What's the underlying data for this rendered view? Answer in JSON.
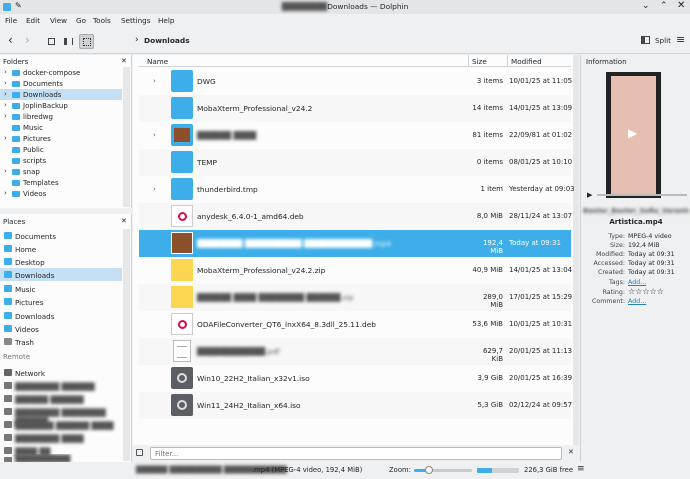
{
  "window": {
    "title_prefix": "████████",
    "title": "Downloads — Dolphin"
  },
  "menu": [
    "File",
    "Edit",
    "View",
    "Go",
    "Tools",
    "Settings",
    "Help"
  ],
  "toolbar": {
    "location": "Downloads",
    "split_label": "Split"
  },
  "folders_panel": {
    "title": "Folders",
    "items": [
      {
        "label": "docker-compose"
      },
      {
        "label": "Documents"
      },
      {
        "label": "Downloads"
      },
      {
        "label": "JoplinBackup"
      },
      {
        "label": "libredwg"
      },
      {
        "label": "Music"
      },
      {
        "label": "Pictures"
      },
      {
        "label": "Public"
      },
      {
        "label": "scripts"
      },
      {
        "label": "snap"
      },
      {
        "label": "Templates"
      },
      {
        "label": "Videos"
      }
    ]
  },
  "places_panel": {
    "title": "Places",
    "items": [
      {
        "label": "Documents"
      },
      {
        "label": "Home"
      },
      {
        "label": "Desktop"
      },
      {
        "label": "Downloads"
      },
      {
        "label": "Music"
      },
      {
        "label": "Pictures"
      },
      {
        "label": "Downloads"
      },
      {
        "label": "Videos"
      },
      {
        "label": "Trash"
      }
    ],
    "remote_title": "Remote",
    "remote_items": [
      {
        "label": "Network"
      },
      {
        "label": "████████ ██████"
      },
      {
        "label": "██████ ██████"
      },
      {
        "label": "████████ ████████ ██████"
      },
      {
        "label": "███████ ██████ ████"
      },
      {
        "label": "████████ ████"
      },
      {
        "label": "████ ██"
      },
      {
        "label": "██████████"
      }
    ]
  },
  "columns": {
    "name": "Name",
    "size": "Size",
    "modified": "Modified"
  },
  "files": [
    {
      "name": "DWG",
      "size": "3 items",
      "modified": "10/01/25 at 11:05",
      "type": "folder",
      "expandable": true
    },
    {
      "name": "MobaXterm_Professional_v24.2",
      "size": "14 items",
      "modified": "14/01/25 at 13:09",
      "type": "folder",
      "expandable": false
    },
    {
      "name": "██████ ████",
      "size": "81 items",
      "modified": "22/09/81 at 01:02",
      "type": "photo-folder",
      "expandable": true
    },
    {
      "name": "TEMP",
      "size": "0 items",
      "modified": "08/01/25 at 10:10",
      "type": "folder",
      "expandable": false
    },
    {
      "name": "thunderbird.tmp",
      "size": "1 item",
      "modified": "Yesterday at 09:03",
      "type": "folder",
      "expandable": true
    },
    {
      "name": "anydesk_6.4.0-1_amd64.deb",
      "size": "8,0 MiB",
      "modified": "28/11/24 at 13:07",
      "type": "deb",
      "expandable": false
    },
    {
      "name": "████████ ██████████ ████████████.mp4",
      "size": "192,4 MiB",
      "modified": "Today at 09:31",
      "type": "video",
      "expandable": false,
      "selected": true
    },
    {
      "name": "MobaXterm_Professional_v24.2.zip",
      "size": "40,9 MiB",
      "modified": "14/01/25 at 13:04",
      "type": "archive",
      "expandable": false
    },
    {
      "name": "██████ ████ ████████ ██████.zip",
      "size": "289,0 MiB",
      "modified": "17/01/25 at 15:29",
      "type": "archive",
      "expandable": false
    },
    {
      "name": "ODAFileConverter_QT6_lnxX64_8.3dll_25.11.deb",
      "size": "53,6 MiB",
      "modified": "10/01/25 at 10:31",
      "type": "deb",
      "expandable": false
    },
    {
      "name": "████████████.pdf",
      "size": "629,7 KiB",
      "modified": "20/01/25 at 11:13",
      "type": "pdf",
      "expandable": false
    },
    {
      "name": "Win10_22H2_Italian_x32v1.iso",
      "size": "3,9 GiB",
      "modified": "20/01/25 at 16:39",
      "type": "iso",
      "expandable": false
    },
    {
      "name": "Win11_24H2_Italian_x64.iso",
      "size": "5,3 GiB",
      "modified": "02/12/24 at 09:57",
      "type": "iso",
      "expandable": false
    }
  ],
  "filter": {
    "placeholder": "Filter..."
  },
  "info_panel": {
    "title": "Information",
    "filename_blur": "Baxter_Baxter_SoRe_Varanteo",
    "filename": "Artistica.mp4",
    "rows": [
      {
        "label": "Type:",
        "value": "MPEG-4 video"
      },
      {
        "label": "Size:",
        "value": "192,4 MiB"
      },
      {
        "label": "Modified:",
        "value": "Today at 09:31"
      },
      {
        "label": "Accessed:",
        "value": "Today at 09:31"
      },
      {
        "label": "Created:",
        "value": "Today at 09:31"
      }
    ],
    "tags_label": "Tags:",
    "tags_value": "Add...",
    "rating_label": "Rating:",
    "rating": "☆☆☆☆☆",
    "comment_label": "Comment:",
    "comment_value": "Add..."
  },
  "statusbar": {
    "file_blur": "██████ ██████████ ████████████",
    "file_info": ".mp4 (MPEG-4 video, 192,4 MiB)",
    "zoom_label": "Zoom:",
    "zoom_fraction": 0.25,
    "space_used_fraction": 0.36,
    "free": "226,3 GiB free"
  },
  "colors": {
    "accent": "#3daee9",
    "selection": "#c5dff5"
  }
}
